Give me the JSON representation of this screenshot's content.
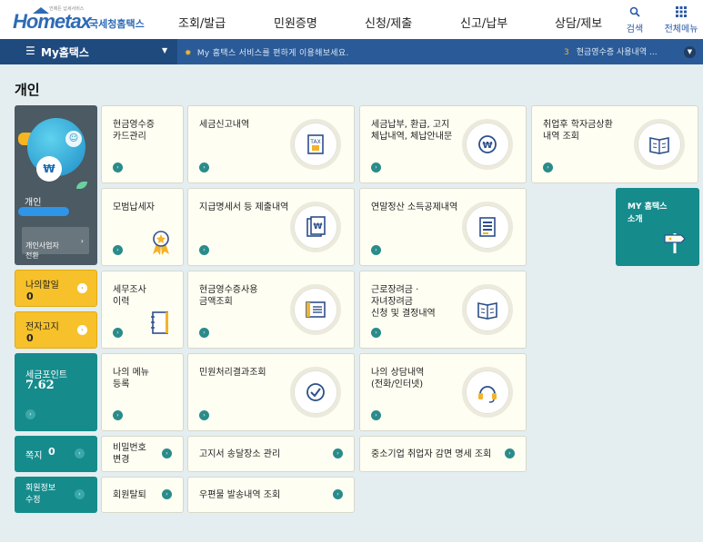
{
  "header": {
    "logo_tagline": "언제든 납세서비스",
    "logo_main": "Hometax",
    "logo_org": "국세청홈택스",
    "menu": [
      "조회/발급",
      "민원증명",
      "신청/제출",
      "신고/납부",
      "상담/제보"
    ],
    "search_label": "검색",
    "allmenu_label": "전체메뉴"
  },
  "navbar": {
    "my_label": "My홈택스",
    "message": "My 홈택스 서비스를 편하게 이용해보세요.",
    "rank_number": "3",
    "rank_text": "현금영수증 사용내역 ..."
  },
  "page_title": "개인",
  "profile": {
    "won_symbol": "₩",
    "user_type": "개인",
    "switch_label": "개인사업자\n전환"
  },
  "sidebar": {
    "my_discount_label": "나의할일",
    "my_discount_count": "0",
    "e_notice_label": "전자고지",
    "e_notice_count": "0",
    "tax_point_label": "세금포인트",
    "tax_point_value": "7.62",
    "note_label": "쪽지",
    "note_count": "0",
    "member_edit_label": "회원정보\n수정"
  },
  "tiles": {
    "cash_receipt_card": "현금영수증\n카드관리",
    "tax_report_history": "세금신고내역",
    "tax_payment_history": "세금납부, 환급, 고지\n체납내역, 체납안내문",
    "student_loan": "취업후 학자금상환\n내역 조회",
    "model_taxpayer": "모범납세자",
    "payment_statement": "지급명세서 등 제출내역",
    "year_end_settlement": "연말정산 소득공제내역",
    "tax_audit": "세무조사\n이력",
    "cash_receipt_usage": "현금영수증사용\n금액조회",
    "earned_income_credit": "근로장려금 ·\n자녀장려금\n신청 및 결정내역",
    "my_menu": "나의 메뉴\n등록",
    "civil_result": "민원처리결과조회",
    "my_consult": "나의 상담내역\n(전화/인터넷)",
    "password_change": "비밀번호\n변경",
    "bill_address": "고지서 송달장소 관리",
    "sme_tax_reduction": "중소기업 취업자 감면 명세 조회",
    "withdrawal": "회원탈퇴",
    "mail_history": "우편물 발송내역 조회",
    "my_hometax_intro": "MY 홈택스\n소개"
  },
  "colors": {
    "header_blue": "#2a5b98",
    "teal": "#168b8c",
    "yellow": "#f6c12a",
    "tile_bg": "#fffef3",
    "page_bg": "#e4eef0"
  }
}
